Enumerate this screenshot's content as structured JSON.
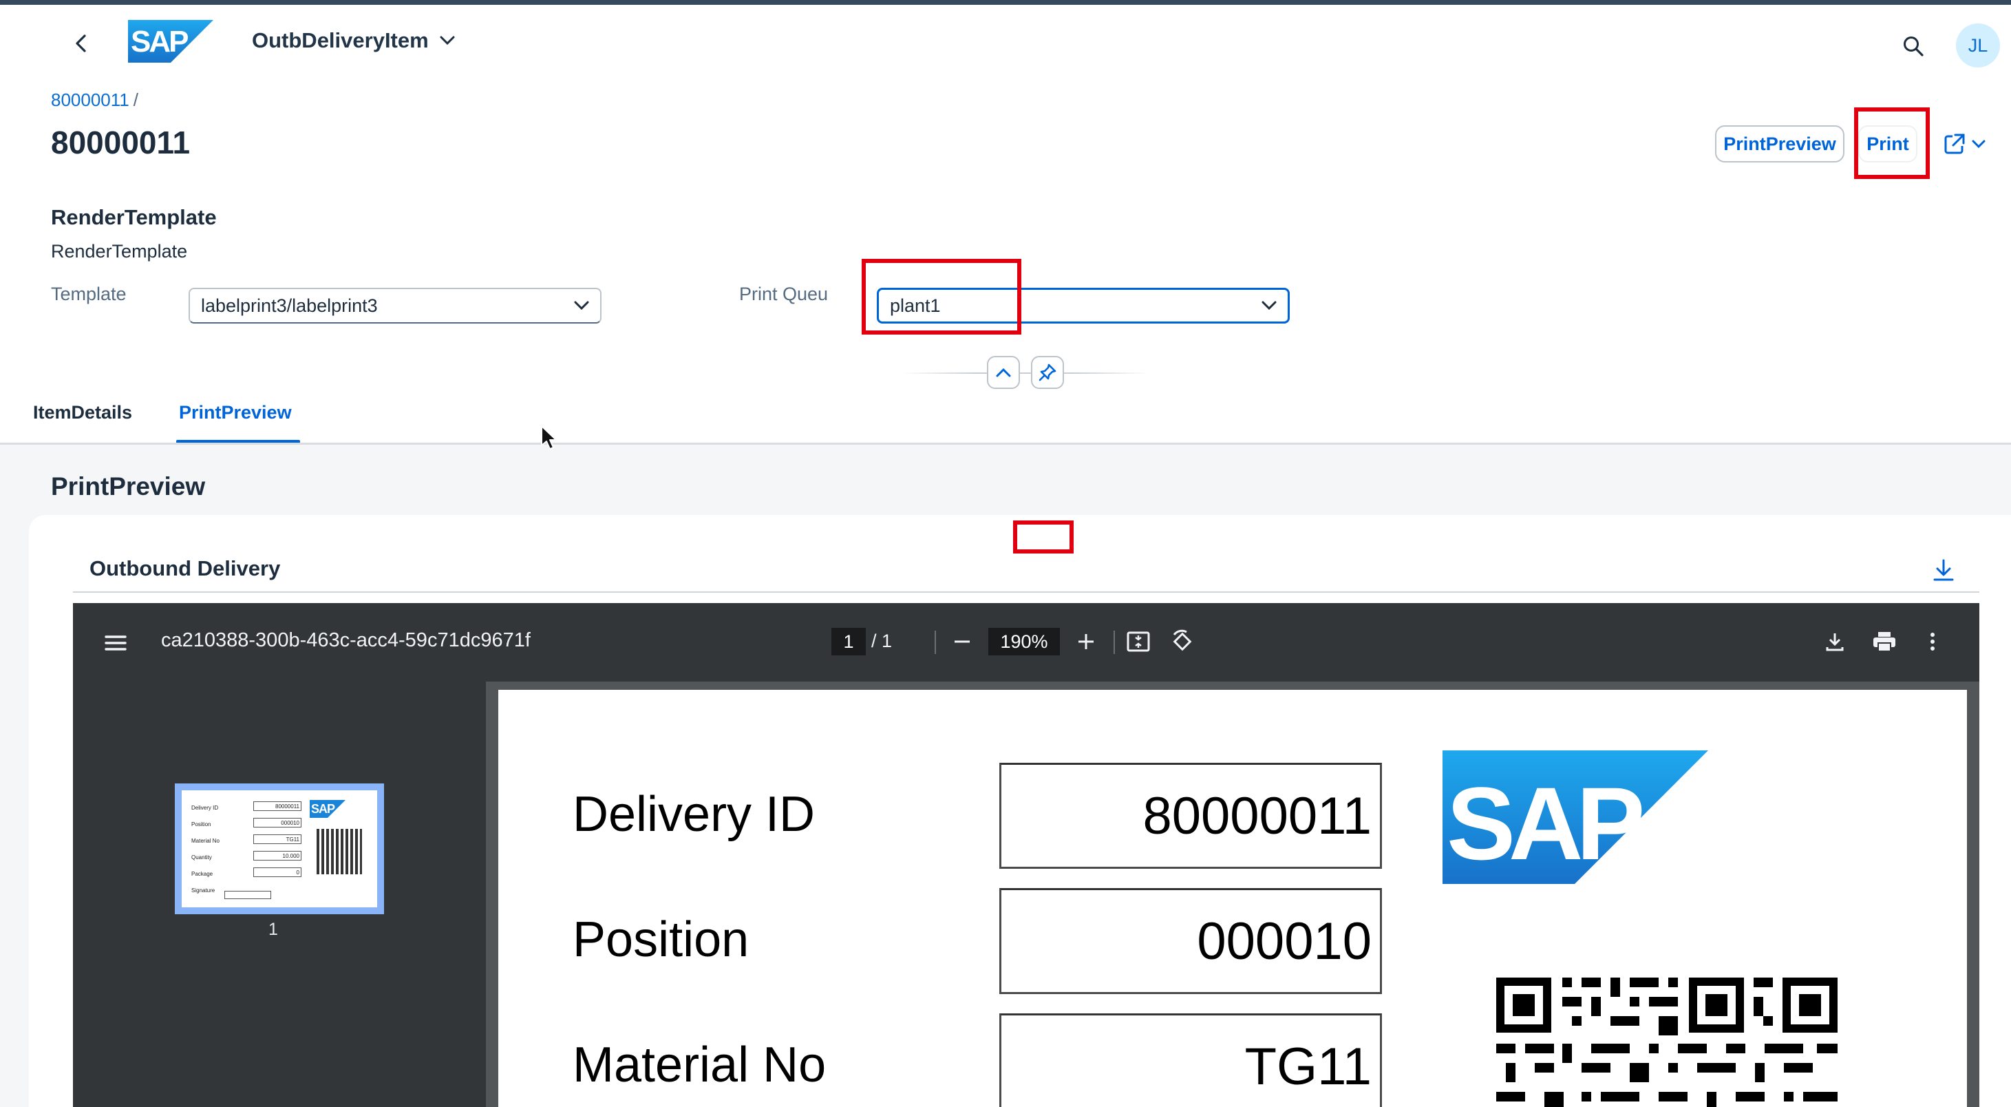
{
  "shell": {
    "app_title": "OutbDeliveryItem",
    "logo_text": "SAP",
    "avatar_initials": "JL",
    "icons": [
      "back-icon",
      "chevron-down-icon",
      "search-icon"
    ]
  },
  "header": {
    "breadcrumb": "80000011",
    "breadcrumb_sep": "/",
    "title": "80000011",
    "actions": {
      "print_preview": "PrintPreview",
      "print": "Print"
    }
  },
  "render_template": {
    "section_title": "RenderTemplate",
    "subtitle": "RenderTemplate",
    "template_label": "Template",
    "template_value": "labelprint3/labelprint3",
    "queue_label": "Print Queu",
    "queue_value": "plant1"
  },
  "tabs": [
    {
      "label": "ItemDetails",
      "selected": false
    },
    {
      "label": "PrintPreview",
      "selected": true
    }
  ],
  "content": {
    "title": "PrintPreview",
    "card_title": "Outbound Delivery"
  },
  "viewer": {
    "file_name": "ca210388-300b-463c-acc4-59c71dc9671f",
    "page_current": "1",
    "page_total": "/  1",
    "zoom": "190%",
    "thumb_page_num": "1",
    "thumb_fields": [
      {
        "label": "Delivery ID",
        "value": "80000011"
      },
      {
        "label": "Position",
        "value": "000010"
      },
      {
        "label": "Material No",
        "value": "TG11"
      },
      {
        "label": "Quantity",
        "value": "10.000"
      },
      {
        "label": "Package",
        "value": "0"
      },
      {
        "label": "Signature",
        "value": ""
      }
    ]
  },
  "document": {
    "logo_text": "SAP",
    "fields": [
      {
        "label": "Delivery ID",
        "value": "80000011"
      },
      {
        "label": "Position",
        "value": "000010"
      },
      {
        "label": "Material No",
        "value": "TG11"
      }
    ]
  },
  "colors": {
    "accent": "#0064d9",
    "annotation": "#e0000f",
    "viewer_toolbar": "#323639",
    "viewer_bg": "#525659",
    "sap_blue": "#0a6ed1"
  }
}
